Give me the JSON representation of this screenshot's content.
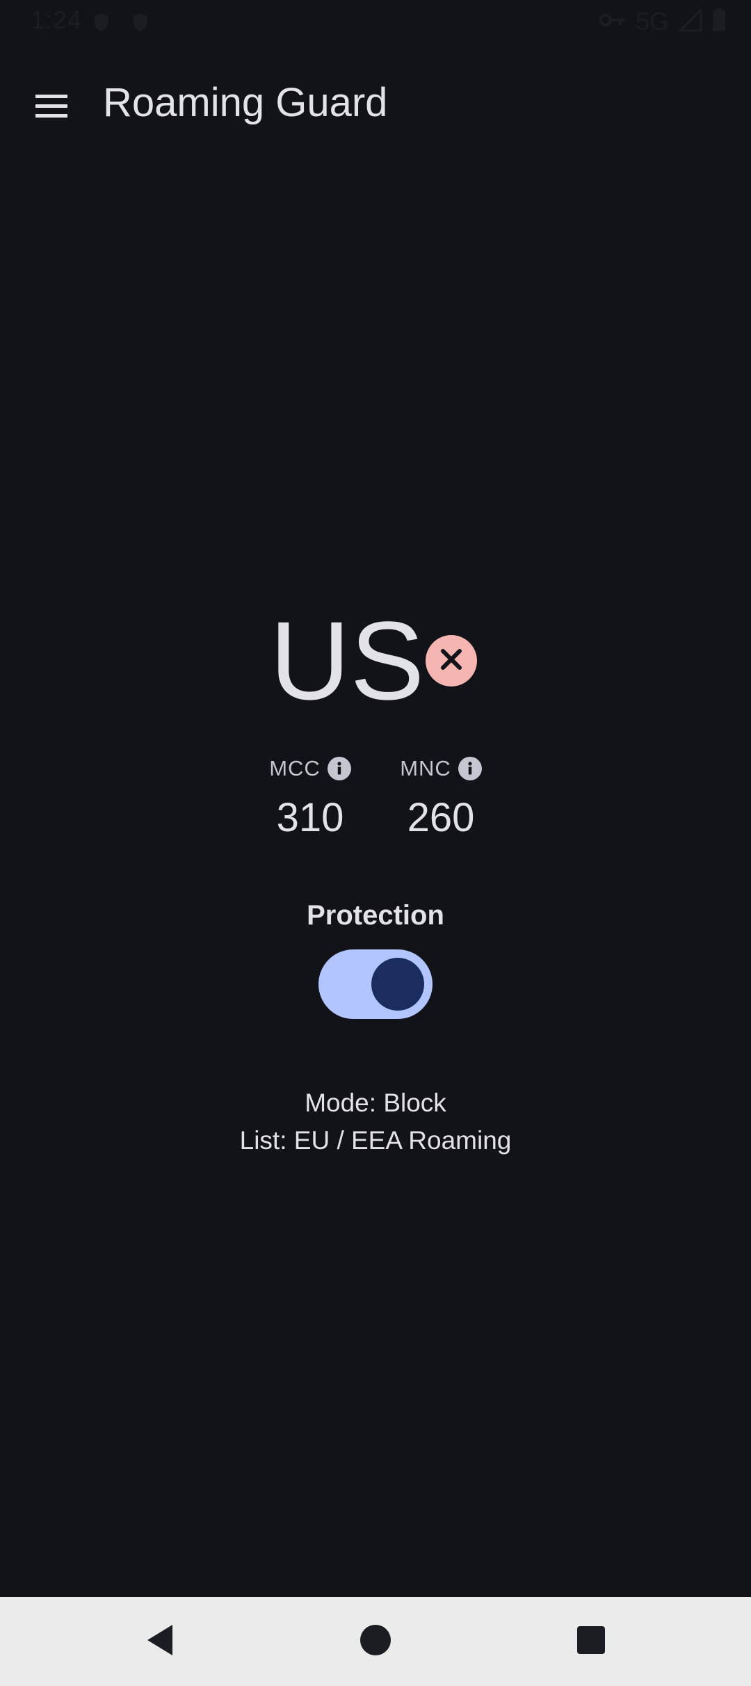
{
  "status_bar": {
    "time": "1:24",
    "network": "5G",
    "icons": [
      "shield-icon",
      "shield-icon",
      "vpn-key-icon",
      "signal-icon",
      "battery-icon"
    ]
  },
  "app_bar": {
    "title": "Roaming Guard",
    "menu_icon": "hamburger-menu-icon"
  },
  "main": {
    "country_code": "US",
    "status_icon": "close-circle-icon",
    "status_color": "#f5b5b1",
    "mcc": {
      "label": "MCC",
      "value": "310"
    },
    "mnc": {
      "label": "MNC",
      "value": "260"
    },
    "protection": {
      "label": "Protection",
      "enabled": true
    },
    "mode_text": "Mode: Block",
    "list_text": "List: EU / EEA Roaming"
  },
  "nav_bar": {
    "icons": [
      "back-icon",
      "home-icon",
      "recents-icon"
    ]
  },
  "colors": {
    "background": "#121318",
    "toggle_track": "#b2c5ff",
    "toggle_knob": "#1a2d5e",
    "nav_bar": "#ebebeb"
  }
}
